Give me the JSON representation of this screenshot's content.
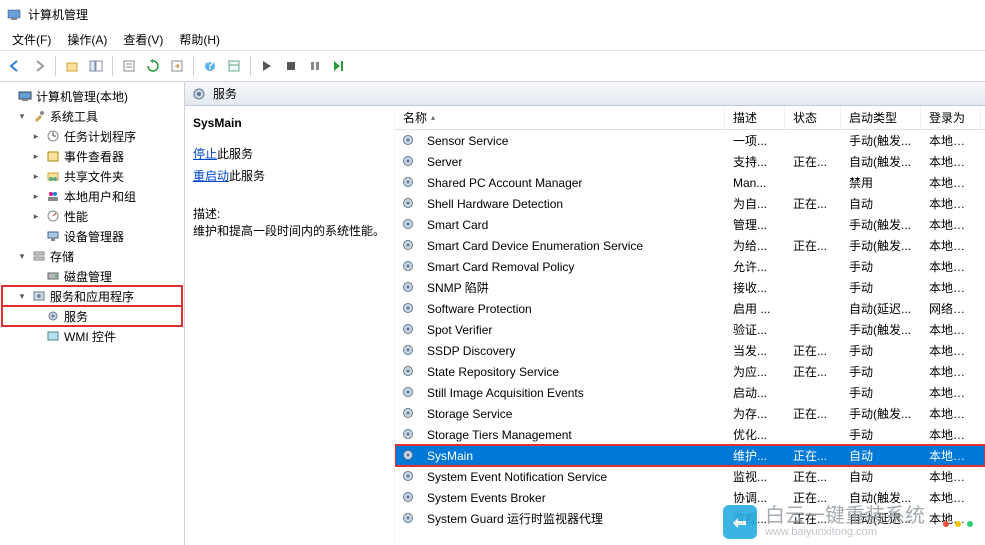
{
  "window": {
    "title": "计算机管理"
  },
  "menu": {
    "file": "文件(F)",
    "action": "操作(A)",
    "view": "查看(V)",
    "help": "帮助(H)"
  },
  "tree": {
    "root": "计算机管理(本地)",
    "system_tools": "系统工具",
    "task_scheduler": "任务计划程序",
    "event_viewer": "事件查看器",
    "shared_folders": "共享文件夹",
    "local_users": "本地用户和组",
    "performance": "性能",
    "device_mgr": "设备管理器",
    "storage": "存储",
    "disk_mgmt": "磁盘管理",
    "services_apps": "服务和应用程序",
    "services": "服务",
    "wmi": "WMI 控件"
  },
  "pane": {
    "header": "服务",
    "detail": {
      "title": "SysMain",
      "stop_link": "停止",
      "stop_suffix": "此服务",
      "restart_link": "重启动",
      "restart_suffix": "此服务",
      "desc_label": "描述:",
      "desc": "维护和提高一段时间内的系统性能。"
    }
  },
  "columns": {
    "name": "名称",
    "desc": "描述",
    "status": "状态",
    "start": "启动类型",
    "logon": "登录为"
  },
  "rows": [
    {
      "name": "Sensor Service",
      "desc": "一项...",
      "status": "",
      "start": "手动(触发...",
      "logon": "本地系统"
    },
    {
      "name": "Server",
      "desc": "支持...",
      "status": "正在...",
      "start": "自动(触发...",
      "logon": "本地系统"
    },
    {
      "name": "Shared PC Account Manager",
      "desc": "Man...",
      "status": "",
      "start": "禁用",
      "logon": "本地系统"
    },
    {
      "name": "Shell Hardware Detection",
      "desc": "为自...",
      "status": "正在...",
      "start": "自动",
      "logon": "本地系统"
    },
    {
      "name": "Smart Card",
      "desc": "管理...",
      "status": "",
      "start": "手动(触发...",
      "logon": "本地服务"
    },
    {
      "name": "Smart Card Device Enumeration Service",
      "desc": "为给...",
      "status": "正在...",
      "start": "手动(触发...",
      "logon": "本地系统"
    },
    {
      "name": "Smart Card Removal Policy",
      "desc": "允许...",
      "status": "",
      "start": "手动",
      "logon": "本地系统"
    },
    {
      "name": "SNMP 陷阱",
      "desc": "接收...",
      "status": "",
      "start": "手动",
      "logon": "本地服务"
    },
    {
      "name": "Software Protection",
      "desc": "启用 ...",
      "status": "",
      "start": "自动(延迟...",
      "logon": "网络服务"
    },
    {
      "name": "Spot Verifier",
      "desc": "验证...",
      "status": "",
      "start": "手动(触发...",
      "logon": "本地系统"
    },
    {
      "name": "SSDP Discovery",
      "desc": "当发...",
      "status": "正在...",
      "start": "手动",
      "logon": "本地服务"
    },
    {
      "name": "State Repository Service",
      "desc": "为应...",
      "status": "正在...",
      "start": "手动",
      "logon": "本地系统"
    },
    {
      "name": "Still Image Acquisition Events",
      "desc": "启动...",
      "status": "",
      "start": "手动",
      "logon": "本地系统"
    },
    {
      "name": "Storage Service",
      "desc": "为存...",
      "status": "正在...",
      "start": "手动(触发...",
      "logon": "本地系统"
    },
    {
      "name": "Storage Tiers Management",
      "desc": "优化...",
      "status": "",
      "start": "手动",
      "logon": "本地系统"
    },
    {
      "name": "SysMain",
      "desc": "维护...",
      "status": "正在...",
      "start": "自动",
      "logon": "本地系统",
      "selected": true
    },
    {
      "name": "System Event Notification Service",
      "desc": "监视...",
      "status": "正在...",
      "start": "自动",
      "logon": "本地系统"
    },
    {
      "name": "System Events Broker",
      "desc": "协调...",
      "status": "正在...",
      "start": "自动(触发...",
      "logon": "本地系统"
    },
    {
      "name": "System Guard 运行时监视器代理",
      "desc": "监视...",
      "status": "正在...",
      "start": "自动(延迟...",
      "logon": "本地系统"
    }
  ],
  "watermark": {
    "brand": "白云一键重装系统",
    "url": "www.baiyunxitong.com"
  }
}
